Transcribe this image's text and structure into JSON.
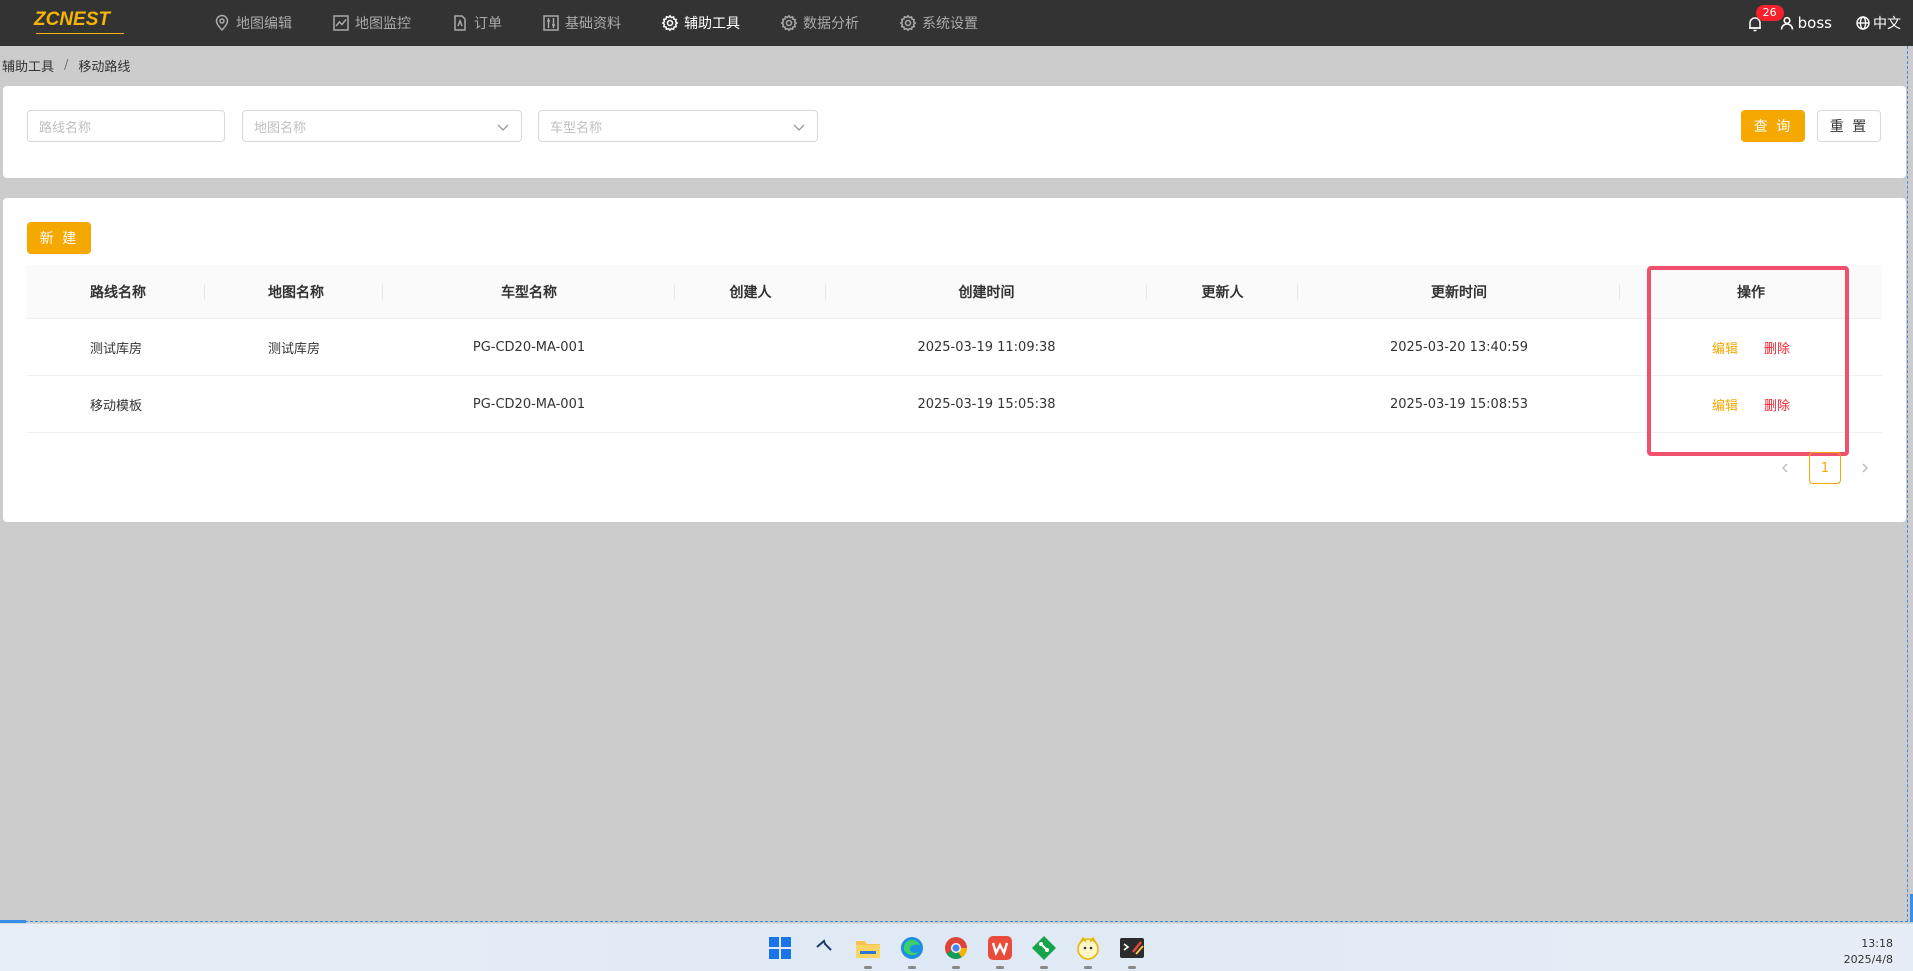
{
  "app": {
    "logo": "ZCNEST",
    "accent": "#f5a800",
    "nav": [
      {
        "label": "地图编辑",
        "icon": "location-pin-icon",
        "active": false
      },
      {
        "label": "地图监控",
        "icon": "line-chart-icon",
        "active": false
      },
      {
        "label": "订单",
        "icon": "document-icon",
        "active": false
      },
      {
        "label": "基础资料",
        "icon": "sliders-icon",
        "active": false
      },
      {
        "label": "辅助工具",
        "icon": "gear-icon",
        "active": true
      },
      {
        "label": "数据分析",
        "icon": "gear-icon",
        "active": false
      },
      {
        "label": "系统设置",
        "icon": "gear-icon",
        "active": false
      }
    ],
    "notifications": "26",
    "user": "boss",
    "language": "中文"
  },
  "breadcrumb": [
    "辅助工具",
    "移动路线"
  ],
  "filters": {
    "route_placeholder": "路线名称",
    "map_placeholder": "地图名称",
    "vehicle_placeholder": "车型名称",
    "query_label": "查 询",
    "reset_label": "重 置"
  },
  "toolbar": {
    "new_label": "新 建"
  },
  "table": {
    "columns": [
      "路线名称",
      "地图名称",
      "车型名称",
      "创建人",
      "创建时间",
      "更新人",
      "更新时间",
      "操作"
    ],
    "rows": [
      {
        "route": "测试库房",
        "map": "测试库房",
        "vehicle": "PG-CD20-MA-001",
        "creator": "",
        "created": "2025-03-19 11:09:38",
        "updater": "",
        "updated": "2025-03-20 13:40:59"
      },
      {
        "route": "移动模板",
        "map": "",
        "vehicle": "PG-CD20-MA-001",
        "creator": "",
        "created": "2025-03-19 15:05:38",
        "updater": "",
        "updated": "2025-03-19 15:08:53"
      }
    ],
    "edit_label": "编辑",
    "delete_label": "删除"
  },
  "pagination": {
    "current": "1"
  },
  "taskbar": {
    "icons": [
      "windows-start-icon",
      "pinned-app-icon",
      "file-explorer-icon",
      "edge-browser-icon",
      "chrome-browser-icon",
      "wps-office-icon",
      "git-app-icon",
      "mascot-app-icon",
      "terminal-app-icon"
    ],
    "time": "13:18",
    "date": "2025/4/8"
  }
}
